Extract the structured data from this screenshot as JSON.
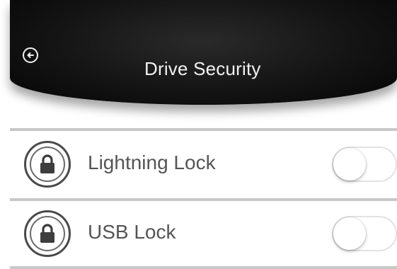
{
  "header": {
    "title": "Drive Security",
    "back_icon": "back-arrow-circle-icon"
  },
  "settings": {
    "items": [
      {
        "label": "Lightning Lock",
        "icon": "padlock-icon",
        "enabled": false
      },
      {
        "label": "USB Lock",
        "icon": "padlock-icon",
        "enabled": false
      }
    ]
  },
  "colors": {
    "header_bg": "#141414",
    "header_text": "#f1f1f1",
    "label_text": "#555555",
    "divider": "#c8c8c8",
    "icon_stroke": "#4a4a4a"
  }
}
